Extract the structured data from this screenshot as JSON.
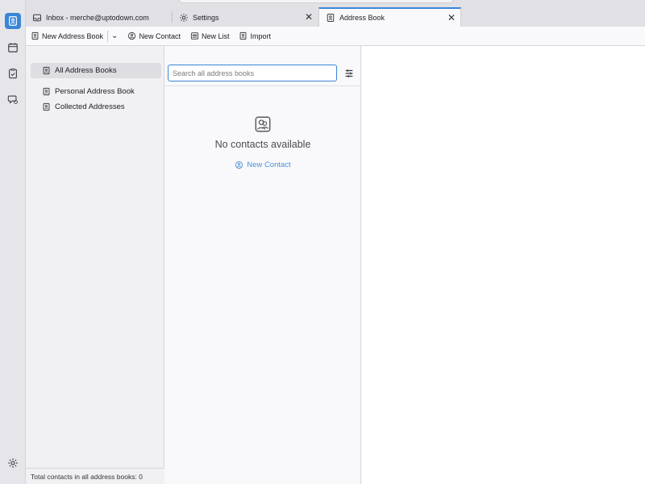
{
  "spaces": {
    "items": [
      "address-book-icon",
      "calendar-icon",
      "tasks-icon",
      "chat-icon"
    ],
    "settings": "gear-icon",
    "active_color": "#3a86d6"
  },
  "tabs": [
    {
      "label": "Inbox - merche@uptodown.com",
      "icon": "inbox-icon",
      "active": false
    },
    {
      "label": "Settings",
      "icon": "gear-icon",
      "active": false
    },
    {
      "label": "Address Book",
      "icon": "address-book-icon",
      "active": true
    }
  ],
  "toolbar": {
    "new_address_book": "New Address Book",
    "new_contact": "New Contact",
    "new_list": "New List",
    "import": "Import"
  },
  "books": {
    "items": [
      {
        "label": "All Address Books",
        "selected": true
      },
      {
        "label": "Personal Address Book",
        "selected": false
      },
      {
        "label": "Collected Addresses",
        "selected": false
      }
    ],
    "footer": "Total contacts in all address books: 0"
  },
  "cards": {
    "search_placeholder": "Search all address books",
    "empty_title": "No contacts available",
    "empty_link": "New Contact"
  }
}
